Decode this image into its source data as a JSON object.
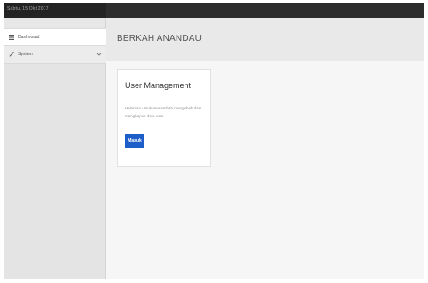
{
  "topbar": {
    "date": "Sabtu, 15 Okt 2017"
  },
  "sidebar": {
    "items": [
      {
        "label": "Dashboard",
        "icon": "bars-icon"
      },
      {
        "label": "System",
        "icon": "wrench-icon",
        "chevron": "chevron-down-icon"
      }
    ]
  },
  "header": {
    "brand": "BERKAH ANANDAU"
  },
  "card": {
    "title": "User Management",
    "description": "Halaman untuk menambah,mengubah dan menghapus data user",
    "button_label": "Masuk"
  },
  "colors": {
    "accent": "#1e5ec9",
    "topbar": "#2d2d2d",
    "sidebar": "#e4e4e4"
  }
}
